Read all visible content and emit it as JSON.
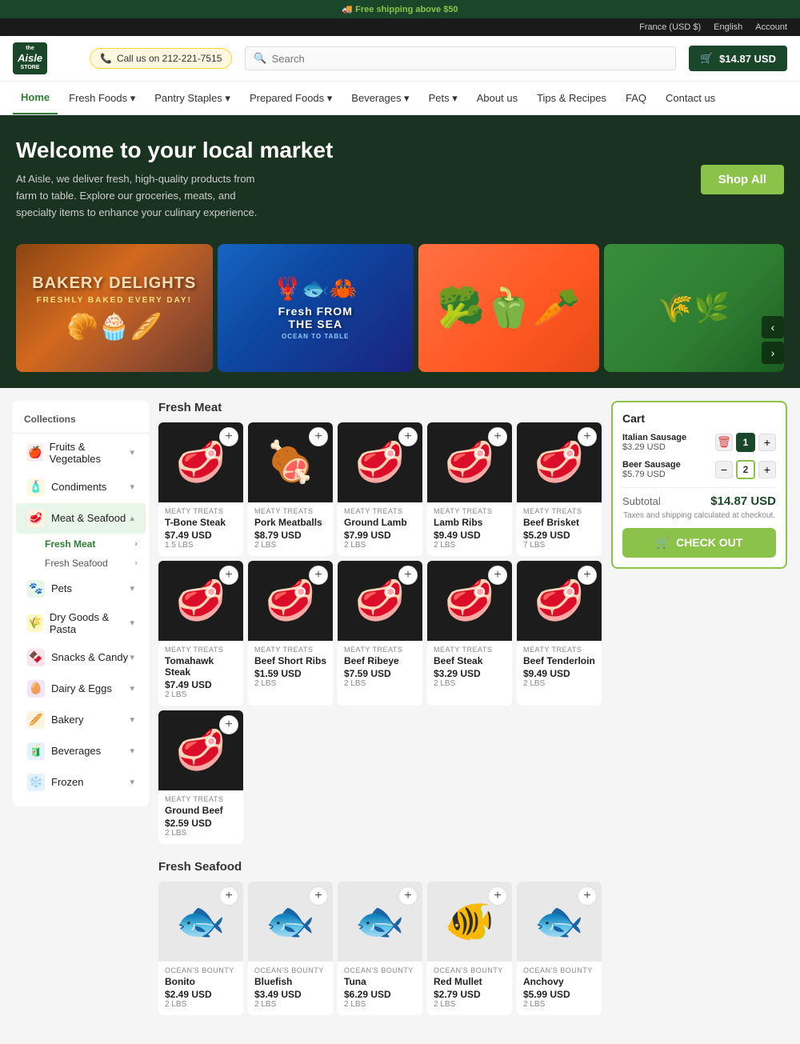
{
  "topBar": {
    "shipping": "🚚 Free shipping above $50",
    "region": "France (USD $)",
    "language": "English",
    "account": "Account"
  },
  "header": {
    "phone": "Call us on 212-221-7515",
    "searchPlaceholder": "Search",
    "cartAmount": "$14.87 USD",
    "logoLine1": "the",
    "logoLine2": "Aisle",
    "logoLine3": "STORE"
  },
  "nav": {
    "items": [
      {
        "label": "Home",
        "active": true
      },
      {
        "label": "Fresh Foods",
        "hasDropdown": true
      },
      {
        "label": "Pantry Staples",
        "hasDropdown": true
      },
      {
        "label": "Prepared Foods",
        "hasDropdown": true
      },
      {
        "label": "Beverages",
        "hasDropdown": true
      },
      {
        "label": "Pets",
        "hasDropdown": true
      },
      {
        "label": "About us",
        "hasDropdown": false
      },
      {
        "label": "Tips & Recipes",
        "hasDropdown": false
      },
      {
        "label": "FAQ",
        "hasDropdown": false
      },
      {
        "label": "Contact us",
        "hasDropdown": false
      }
    ]
  },
  "hero": {
    "title": "Welcome to your local market",
    "description": "At Aisle, we deliver fresh, high-quality products from farm to table. Explore our groceries, meats, and specialty items to enhance your culinary experience.",
    "shopAllLabel": "Shop All"
  },
  "banners": [
    {
      "title": "BAKERY DELIGHTS",
      "subtitle": "FRESHLY BAKED EVERY DAY!",
      "type": "bakery"
    },
    {
      "title": "Fresh FROM THE SEA",
      "subtitle": "OCEAN TO TABLE",
      "type": "sea"
    },
    {
      "type": "veggie"
    },
    {
      "type": "field"
    }
  ],
  "sidebar": {
    "collectionsLabel": "Collections",
    "items": [
      {
        "label": "Fruits & Vegetables",
        "icon": "🍎",
        "iconBg": "#ffebee",
        "expanded": false
      },
      {
        "label": "Condiments",
        "icon": "🧴",
        "iconBg": "#fff8e1",
        "expanded": false
      },
      {
        "label": "Meat & Seafood",
        "icon": "🥩",
        "iconBg": "#fff3e0",
        "expanded": true,
        "active": true
      },
      {
        "label": "Pets",
        "icon": "🐾",
        "iconBg": "#e8f5e9",
        "expanded": false
      },
      {
        "label": "Dry Goods & Pasta",
        "icon": "🌾",
        "iconBg": "#fff9c4",
        "expanded": false
      },
      {
        "label": "Snacks & Candy",
        "icon": "🍫",
        "iconBg": "#fce4ec",
        "expanded": false
      },
      {
        "label": "Dairy & Eggs",
        "icon": "🥚",
        "iconBg": "#f3e5f5",
        "expanded": false
      },
      {
        "label": "Bakery",
        "icon": "🥖",
        "iconBg": "#fff3e0",
        "expanded": false
      },
      {
        "label": "Beverages",
        "icon": "🧃",
        "iconBg": "#e3f2fd",
        "expanded": false
      },
      {
        "label": "Frozen",
        "icon": "❄️",
        "iconBg": "#e3f2fd",
        "expanded": false
      }
    ],
    "subItems": [
      {
        "label": "Fresh Meat",
        "active": true
      },
      {
        "label": "Fresh Seafood",
        "active": false
      }
    ]
  },
  "freshMeat": {
    "sectionTitle": "Fresh Meat",
    "products": [
      {
        "brand": "MEATY TREATS",
        "name": "T-Bone Steak",
        "price": "$7.49 USD",
        "weight": "1.5 LBS",
        "type": "steak"
      },
      {
        "brand": "MEATY TREATS",
        "name": "Pork Meatballs",
        "price": "$8.79 USD",
        "weight": "2 LBS",
        "type": "meatball"
      },
      {
        "brand": "MEATY TREATS",
        "name": "Ground Lamb",
        "price": "$7.99 USD",
        "weight": "2 LBS",
        "type": "lamb"
      },
      {
        "brand": "MEATY TREATS",
        "name": "Lamb Ribs",
        "price": "$9.49 USD",
        "weight": "2 LBS",
        "type": "ribs"
      },
      {
        "brand": "MEATY TREATS",
        "name": "Beef Brisket",
        "price": "$5.29 USD",
        "weight": "7 LBS",
        "type": "brisket"
      },
      {
        "brand": "MEATY TREATS",
        "name": "Tomahawk Steak",
        "price": "$7.49 USD",
        "weight": "2 LBS",
        "type": "tomahawk"
      },
      {
        "brand": "MEATY TREATS",
        "name": "Beef Short Ribs",
        "price": "$1.59 USD",
        "weight": "2 LBS",
        "type": "shortribs"
      },
      {
        "brand": "MEATY TREATS",
        "name": "Beef Ribeye",
        "price": "$7.59 USD",
        "weight": "2 LBS",
        "type": "ribeye"
      },
      {
        "brand": "MEATY TREATS",
        "name": "Beef Steak",
        "price": "$3.29 USD",
        "weight": "2 LBS",
        "type": "steak2"
      },
      {
        "brand": "MEATY TREATS",
        "name": "Beef Tenderloin",
        "price": "$9.49 USD",
        "weight": "2 LBS",
        "type": "tenderloin"
      },
      {
        "brand": "MEATY TREATS",
        "name": "Ground Beef",
        "price": "$2.59 USD",
        "weight": "2 LBS",
        "type": "groundbeef"
      }
    ]
  },
  "freshSeafood": {
    "sectionTitle": "Fresh Seafood",
    "products": [
      {
        "brand": "OCEAN'S BOUNTY",
        "name": "Bonito",
        "price": "$2.49 USD",
        "weight": "2 LBS",
        "type": "fish"
      },
      {
        "brand": "OCEAN'S BOUNTY",
        "name": "Bluefish",
        "price": "$3.49 USD",
        "weight": "2 LBS",
        "type": "fish"
      },
      {
        "brand": "OCEAN'S BOUNTY",
        "name": "Tuna",
        "price": "$6.29 USD",
        "weight": "2 LBS",
        "type": "fish"
      },
      {
        "brand": "OCEAN'S BOUNTY",
        "name": "Red Mullet",
        "price": "$2.79 USD",
        "weight": "2 LBS",
        "type": "fish"
      },
      {
        "brand": "OCEAN'S BOUNTY",
        "name": "Anchovy",
        "price": "$5.99 USD",
        "weight": "2 LBS",
        "type": "fish"
      }
    ]
  },
  "cart": {
    "title": "Cart",
    "items": [
      {
        "name": "Italian Sausage",
        "price": "$3.29 USD",
        "qty": 1,
        "qtyStyle": "dark"
      },
      {
        "name": "Beer Sausage",
        "price": "$5.79 USD",
        "qty": 2,
        "qtyStyle": "outline"
      }
    ],
    "subtotalLabel": "Subtotal",
    "subtotalAmount": "$14.87 USD",
    "taxNote": "Taxes and shipping calculated at checkout.",
    "checkoutLabel": "CHECK OUT"
  },
  "icons": {
    "search": "🔍",
    "cart": "🛒",
    "phone": "📞",
    "chevronDown": "▾",
    "chevronRight": "›",
    "plus": "+",
    "minus": "−",
    "trash": "🗑",
    "left": "‹",
    "right": "›"
  }
}
